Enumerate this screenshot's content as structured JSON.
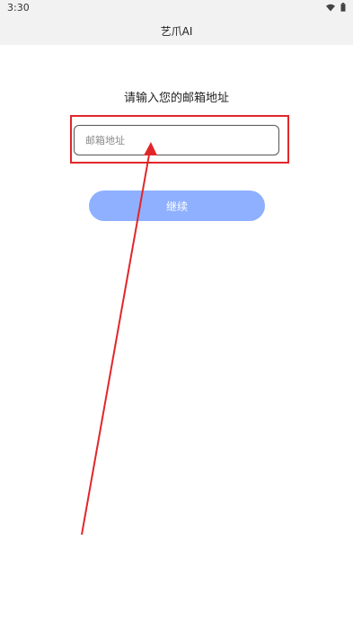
{
  "status_bar": {
    "time": "3:30",
    "icons": [
      "wifi-icon",
      "battery-icon"
    ]
  },
  "app_bar": {
    "title": "艺爪AI"
  },
  "login": {
    "prompt": "请输入您的邮箱地址",
    "email_placeholder": "邮箱地址",
    "email_value": "",
    "continue_label": "继续"
  },
  "colors": {
    "button_bg": "#8fb0ff",
    "annotation_red": "#e1262a",
    "bar_bg": "#f2f2f2"
  }
}
